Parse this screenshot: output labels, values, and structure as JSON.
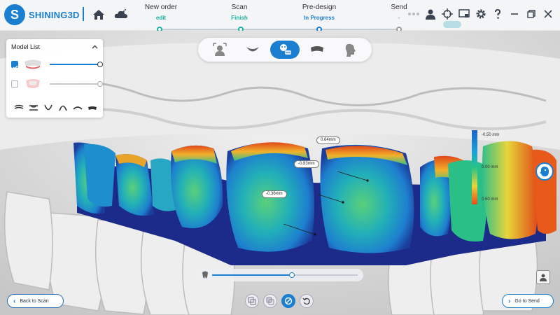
{
  "app": {
    "brand": "SHINING3D"
  },
  "steps": [
    {
      "title": "New order",
      "status": "edit",
      "state": "done"
    },
    {
      "title": "Scan",
      "status": "Finish",
      "state": "done"
    },
    {
      "title": "Pre-design",
      "status": "In Progress",
      "state": "progress"
    },
    {
      "title": "Send",
      "status": "-",
      "state": "pending"
    }
  ],
  "view_toolbar": {
    "buttons": [
      "face-view",
      "lower-jaw-view",
      "smile-design-view",
      "upper-jaw-view",
      "profile-view"
    ],
    "active_index": 2
  },
  "model_list": {
    "title": "Model List",
    "items": [
      {
        "checked": true,
        "opacity": 1.0
      },
      {
        "checked": false,
        "opacity": 1.0
      }
    ]
  },
  "measurements": [
    {
      "text": "0.64mm"
    },
    {
      "text": "-0.83mm"
    },
    {
      "text": "-0.36mm"
    }
  ],
  "color_scale": {
    "labels": [
      "-0.50 mm",
      "0.00 mm",
      "0.50 mm"
    ]
  },
  "bottom": {
    "back_label": "Back to Scan",
    "send_label": "Go to Send",
    "slider_value": 0.55
  },
  "colors": {
    "accent": "#1b7fd1",
    "done": "#19b4a3"
  }
}
